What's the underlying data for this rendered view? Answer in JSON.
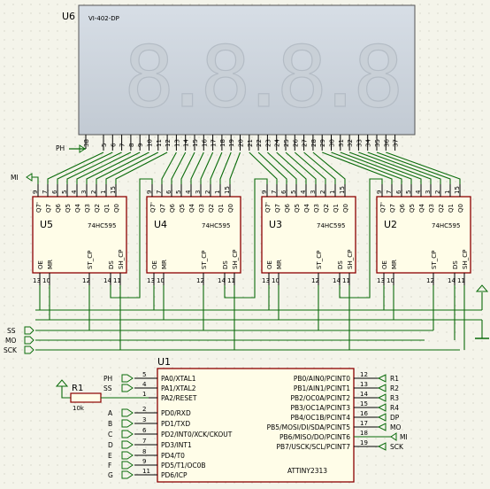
{
  "display": {
    "ref": "U6",
    "part": "VI-402-DP",
    "digits": "8.8.8.8",
    "pins": [
      "5",
      "6",
      "7",
      "8",
      "9",
      "10",
      "11",
      "12",
      "13",
      "14",
      "15",
      "16",
      "17",
      "18",
      "19",
      "20",
      "21",
      "22",
      "23",
      "24",
      "25",
      "26",
      "27",
      "28",
      "29",
      "30",
      "31",
      "32",
      "33",
      "34",
      "35",
      "36",
      "37"
    ],
    "ph_label": "PH",
    "ph_pin": "38"
  },
  "shift_registers": [
    {
      "ref": "U5",
      "part": "74HC595"
    },
    {
      "ref": "U4",
      "part": "74HC595"
    },
    {
      "ref": "U3",
      "part": "74HC595"
    },
    {
      "ref": "U2",
      "part": "74HC595"
    }
  ],
  "sr_top_pins": [
    "9",
    "7",
    "6",
    "5",
    "4",
    "3",
    "2",
    "1",
    "15"
  ],
  "sr_top_labels": [
    "Q7'",
    "Q7",
    "Q6",
    "Q5",
    "Q4",
    "Q3",
    "Q2",
    "Q1",
    "Q0"
  ],
  "sr_bottom_labels": [
    "OE",
    "MR",
    "ST_CP",
    "DS",
    "SH_CP"
  ],
  "sr_bottom_pins": [
    "13",
    "10",
    "12",
    "14",
    "11"
  ],
  "buses": {
    "mi": "MI",
    "ss": "SS",
    "mo": "MO",
    "sck": "SCK"
  },
  "mcu": {
    "ref": "U1",
    "part": "ATTINY2313",
    "left": [
      {
        "sig": "PH",
        "pin": "5",
        "name": "PA0/XTAL1"
      },
      {
        "sig": "SS",
        "pin": "4",
        "name": "PA1/XTAL2"
      },
      {
        "sig": "",
        "pin": "1",
        "name": "PA2/RESET"
      },
      {
        "sig": "A",
        "pin": "2",
        "name": "PD0/RXD"
      },
      {
        "sig": "B",
        "pin": "3",
        "name": "PD1/TXD"
      },
      {
        "sig": "C",
        "pin": "6",
        "name": "PD2/INT0/XCK/CKOUT"
      },
      {
        "sig": "D",
        "pin": "7",
        "name": "PD3/INT1"
      },
      {
        "sig": "E",
        "pin": "8",
        "name": "PD4/T0"
      },
      {
        "sig": "F",
        "pin": "9",
        "name": "PD5/T1/OC0B"
      },
      {
        "sig": "G",
        "pin": "11",
        "name": "PD6/ICP"
      }
    ],
    "right": [
      {
        "sig": "R1",
        "pin": "12",
        "name": "PB0/AIN0/PCINT0"
      },
      {
        "sig": "R2",
        "pin": "13",
        "name": "PB1/AIN1/PCINT1"
      },
      {
        "sig": "R3",
        "pin": "14",
        "name": "PB2/OC0A/PCINT2"
      },
      {
        "sig": "R4",
        "pin": "15",
        "name": "PB3/OC1A/PCINT3"
      },
      {
        "sig": "DP",
        "pin": "16",
        "name": "PB4/OC1B/PCINT4"
      },
      {
        "sig": "MO",
        "pin": "17",
        "name": "PB5/MOSI/DI/SDA/PCINT5"
      },
      {
        "sig": "MI",
        "pin": "18",
        "name": "PB6/MISO/DO/PCINT6"
      },
      {
        "sig": "SCK",
        "pin": "19",
        "name": "PB7/USCK/SCL/PCINT7"
      }
    ]
  },
  "resistor": {
    "ref": "R1",
    "value": "10k"
  }
}
